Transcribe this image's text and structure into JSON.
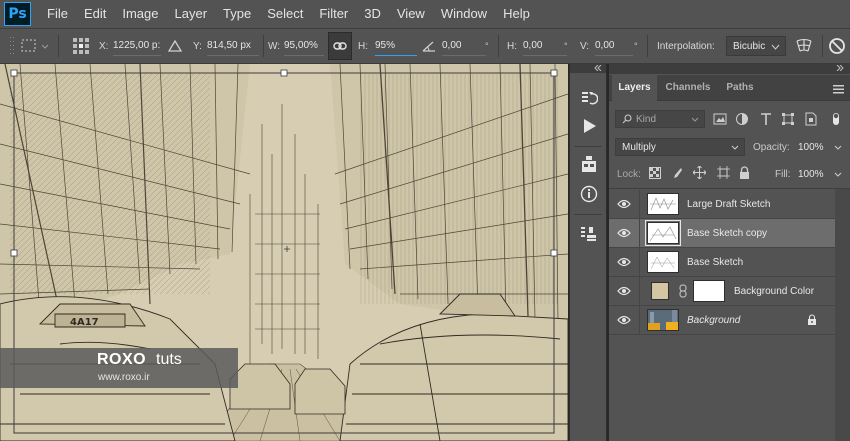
{
  "app": {
    "logo": "Ps",
    "menu": [
      "File",
      "Edit",
      "Image",
      "Layer",
      "Type",
      "Select",
      "Filter",
      "3D",
      "View",
      "Window",
      "Help"
    ]
  },
  "options": {
    "x_label": "X:",
    "x_value": "1225,00 p:",
    "y_label": "Y:",
    "y_value": "814,50 px",
    "w_label": "W:",
    "w_value": "95,00%",
    "h_label": "H:",
    "h_value": "95%",
    "angle_value": "0,00",
    "hskew_label": "H:",
    "hskew_value": "0,00",
    "vskew_label": "V:",
    "vskew_value": "0,00",
    "degree": "°",
    "interp_label": "Interpolation:",
    "interp_value": "Bicubic"
  },
  "watermark": {
    "brand": "ROXO",
    "suffix": "tuts",
    "url": "www.roxo.ir"
  },
  "panel": {
    "tabs": [
      "Layers",
      "Channels",
      "Paths"
    ],
    "filter_kind": "Kind",
    "blend_mode": "Multiply",
    "opacity_label": "Opacity:",
    "opacity_value": "100%",
    "lock_label": "Lock:",
    "fill_label": "Fill:",
    "fill_value": "100%",
    "layers": [
      {
        "name": "Large Draft Sketch"
      },
      {
        "name": "Base Sketch copy"
      },
      {
        "name": "Base Sketch"
      },
      {
        "name": "Background Color"
      },
      {
        "name": "Background"
      }
    ]
  },
  "colors": {
    "ui_bg": "#535353",
    "canvas_paper": "#d7cdb2",
    "accent_blue": "#2fa3f7",
    "selected_layer": "#6d6d6d",
    "color_fill_swatch": "#d4c6a3"
  }
}
